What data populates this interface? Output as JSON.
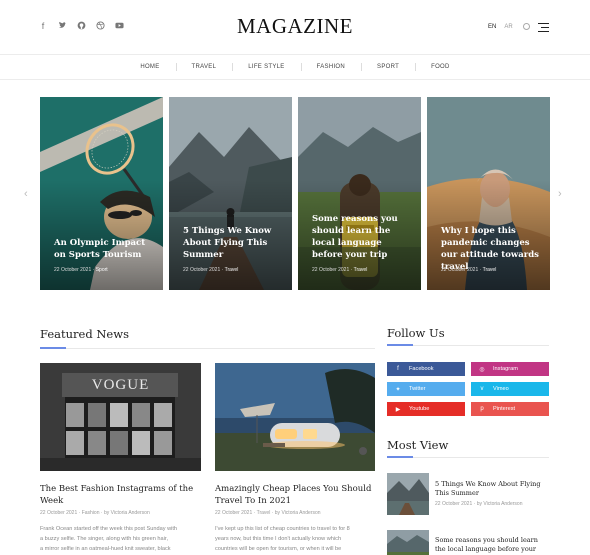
{
  "header": {
    "logo": "MAGAZINE",
    "social_icons": [
      "facebook-icon",
      "twitter-icon",
      "github-icon",
      "dribbble-icon",
      "youtube-icon"
    ],
    "languages": [
      "EN",
      "AR"
    ]
  },
  "nav": {
    "items": [
      "HOME",
      "TRAVEL",
      "LIFE STYLE",
      "FASHION",
      "SPORT",
      "FOOD"
    ]
  },
  "slider": {
    "cards": [
      {
        "title": "An Olympic Impact on Sports Tourism",
        "date": "22 October 2021",
        "category": "Sport"
      },
      {
        "title": "5 Things We Know About Flying This Summer",
        "date": "22 October 2021",
        "category": "Travel"
      },
      {
        "title": "Some reasons you should learn the local language before your trip",
        "date": "22 October 2021",
        "category": "Travel"
      },
      {
        "title": "Why I hope this pandemic changes our attitude towards travel",
        "date": "22 October 2021",
        "category": "Travel"
      }
    ]
  },
  "featured": {
    "heading": "Featured News",
    "posts": [
      {
        "image_text": "VOGUE",
        "title": "The Best Fashion Instagrams of the Week",
        "date": "22 October 2021",
        "category": "Fashion",
        "author": "by Victoria Anderson",
        "excerpt_lines": [
          "Frank Ocean started off the week this post Sunday with",
          "a buzzy selfie. The singer, along with his green hair,",
          "a mirror selfie in an oatmeal-hued knit sweater, black"
        ]
      },
      {
        "title": "Amazingly Cheap Places You Should Travel To In 2021",
        "date": "22 October 2021",
        "category": "Travel",
        "author": "by Victoria Anderson",
        "excerpt_lines": [
          "I've kept up this list of cheap countries to travel to for 8",
          "years now, but this time I don't actually know which",
          "countries will be open for tourism, or when it will be"
        ]
      }
    ]
  },
  "follow": {
    "heading": "Follow Us",
    "buttons": [
      {
        "label": "Facebook",
        "color": "#3b5998",
        "icon": "facebook-icon"
      },
      {
        "label": "Instagram",
        "color": "#c13584",
        "icon": "instagram-icon"
      },
      {
        "label": "Twitter",
        "color": "#55acee",
        "icon": "twitter-icon"
      },
      {
        "label": "Vimeo",
        "color": "#1ab7ea",
        "icon": "vimeo-icon"
      },
      {
        "label": "Youtube",
        "color": "#e52d27",
        "icon": "youtube-icon"
      },
      {
        "label": "Pinterest",
        "color": "#e9544f",
        "icon": "pinterest-icon"
      }
    ]
  },
  "most_view": {
    "heading": "Most View",
    "items": [
      {
        "title": "5 Things We Know About Flying This Summer",
        "date": "22 October 2021",
        "author": "by Victoria Anderson"
      },
      {
        "title": "Some reasons you should learn the local language before your trip",
        "date": "",
        "author": ""
      }
    ]
  },
  "colors": {
    "accent": "#6b8be6"
  }
}
